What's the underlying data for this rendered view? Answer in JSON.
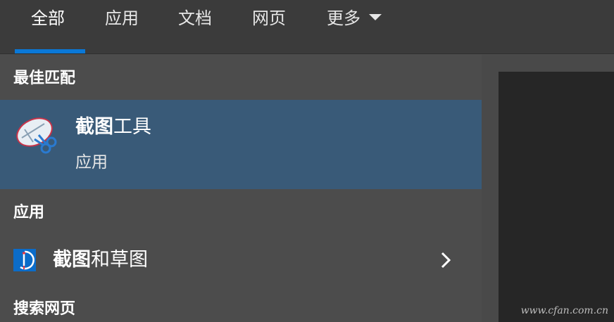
{
  "tabs": {
    "all": "全部",
    "apps": "应用",
    "docs": "文档",
    "web": "网页",
    "more": "更多"
  },
  "sections": {
    "best_match": "最佳匹配",
    "apps": "应用",
    "web_search": "搜索网页"
  },
  "best_match_item": {
    "title_bold": "截图",
    "title_rest": "工具",
    "subtitle": "应用",
    "icon": "snipping-tool-icon"
  },
  "app_item": {
    "label_bold": "截图",
    "label_rest": "和草图",
    "icon": "snip-sketch-icon",
    "chevron_icon": "chevron-right-icon"
  },
  "watermark": "www.cfan.com.cn",
  "colors": {
    "accent": "#0a78d7",
    "selected_row": "#395a78",
    "background": "#4c4c4c",
    "tabbar": "#3b3b3b"
  }
}
